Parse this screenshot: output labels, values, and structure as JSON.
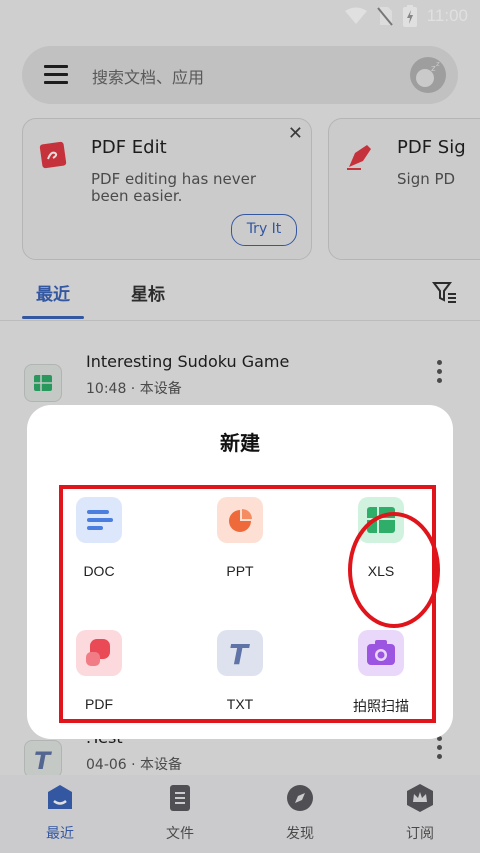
{
  "status_bar": {
    "time": "11:00"
  },
  "search": {
    "placeholder": "搜索文档、应用"
  },
  "promos": [
    {
      "title": "PDF Edit",
      "description": "PDF editing has never been easier.",
      "button": "Try It",
      "close": "✕"
    },
    {
      "title": "PDF Sig",
      "description": "Sign PD"
    }
  ],
  "tabs": {
    "recent": "最近",
    "starred": "星标"
  },
  "files": [
    {
      "name": "Interesting Sudoku Game",
      "meta": "10:48 · 本设备"
    },
    {
      "name": ".Test",
      "meta": "04-06 · 本设备"
    }
  ],
  "dialog": {
    "title": "新建",
    "items": [
      {
        "label": "DOC",
        "icon": "doc-icon",
        "color": "#4a7fe0"
      },
      {
        "label": "PPT",
        "icon": "ppt-icon",
        "color": "#ef6a3a"
      },
      {
        "label": "XLS",
        "icon": "xls-icon",
        "color": "#2fae69"
      },
      {
        "label": "PDF",
        "icon": "pdf-icon",
        "color": "#ea4a56"
      },
      {
        "label": "TXT",
        "icon": "txt-icon",
        "color": "#5f73a6"
      },
      {
        "label": "拍照扫描",
        "icon": "camera-icon",
        "color": "#9b55e0"
      }
    ]
  },
  "bottom_nav": [
    {
      "label": "最近",
      "icon": "recent-icon",
      "active": true
    },
    {
      "label": "文件",
      "icon": "files-icon"
    },
    {
      "label": "发现",
      "icon": "discover-icon"
    },
    {
      "label": "订阅",
      "icon": "subscribe-icon"
    }
  ],
  "colors": {
    "accent": "#3b63b8",
    "highlight": "#e0141b"
  }
}
